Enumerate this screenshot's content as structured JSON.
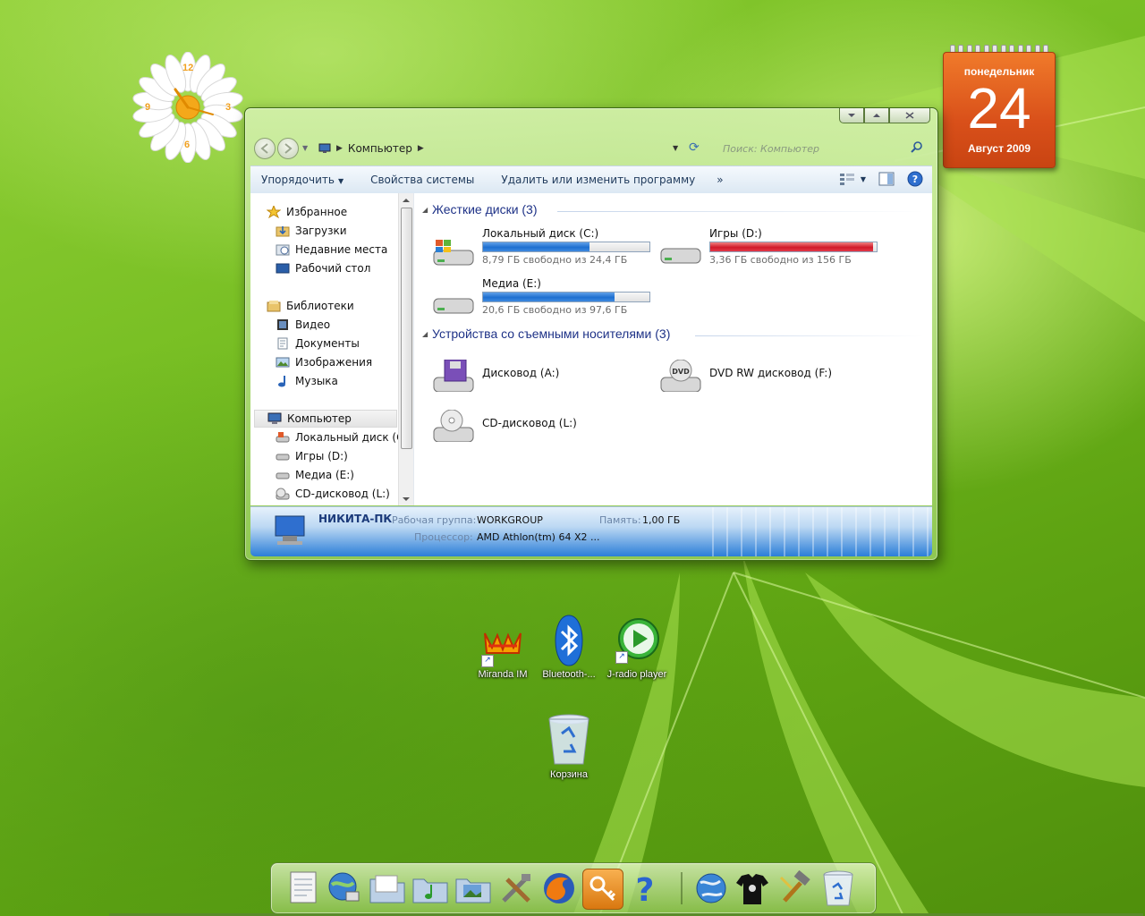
{
  "gadgets": {
    "clock": {
      "numerals": [
        "12",
        "3",
        "6",
        "9"
      ]
    },
    "calendar": {
      "day_name": "понедельник",
      "day": "24",
      "month_year": "Август 2009"
    }
  },
  "window": {
    "address": {
      "location": "Компьютер",
      "search_placeholder": "Поиск: Компьютер"
    },
    "toolbar": {
      "organize": "Упорядочить",
      "system_properties": "Свойства системы",
      "uninstall": "Удалить или изменить программу",
      "more": "»"
    },
    "nav": {
      "favorites": "Избранное",
      "downloads": "Загрузки",
      "recent": "Недавние места",
      "desktop": "Рабочий стол",
      "libraries": "Библиотеки",
      "video": "Видео",
      "documents": "Документы",
      "pictures": "Изображения",
      "music": "Музыка",
      "computer": "Компьютер",
      "drive_c": "Локальный диск (C:)",
      "drive_d": "Игры (D:)",
      "drive_e": "Медиа (E:)",
      "drive_l": "CD-дисковод (L:)"
    },
    "groups": {
      "hard_disks": "Жесткие диски (3)",
      "removable": "Устройства со съемными носителями (3)"
    },
    "drives": [
      {
        "name": "Локальный диск (C:)",
        "free": "8,79 ГБ свободно из 24,4 ГБ",
        "used_fraction": 0.64,
        "color": "#1e6fd0"
      },
      {
        "name": "Игры (D:)",
        "free": "3,36 ГБ свободно из 156 ГБ",
        "used_fraction": 0.98,
        "color": "#d11a2a"
      },
      {
        "name": "Медиа (E:)",
        "free": "20,6 ГБ свободно из 97,6 ГБ",
        "used_fraction": 0.79,
        "color": "#1e6fd0"
      }
    ],
    "devices": {
      "floppy": "Дисковод (A:)",
      "dvd": "DVD RW дисковод (F:)",
      "dvd_icon_text": "DVD",
      "cd": "CD-дисковод (L:)"
    },
    "details": {
      "pc_name": "НИКИТА-ПК",
      "workgroup_label": "Рабочая группа:",
      "workgroup_value": "WORKGROUP",
      "memory_label": "Память:",
      "memory_value": "1,00 ГБ",
      "cpu_label": "Процессор:",
      "cpu_value": "AMD Athlon(tm) 64 X2 ..."
    }
  },
  "desktop_icons": {
    "miranda": "Miranda IM",
    "bluetooth": "Bluetooth-...",
    "jradio": "J-radio player",
    "recycle": "Корзина"
  },
  "dock": {
    "items": [
      "notepad-icon",
      "network-globe-icon",
      "folder-icon",
      "music-folder-icon",
      "pictures-folder-icon",
      "tools-icon",
      "firefox-icon",
      "key-icon",
      "help-icon",
      "globe-icon",
      "tshirt-icon",
      "hammer-icon",
      "recycle-bin-icon"
    ]
  },
  "colors": {
    "accent": "#1e3287",
    "desktop_green": "#76bd22",
    "calendar_orange": "#d9501a"
  }
}
